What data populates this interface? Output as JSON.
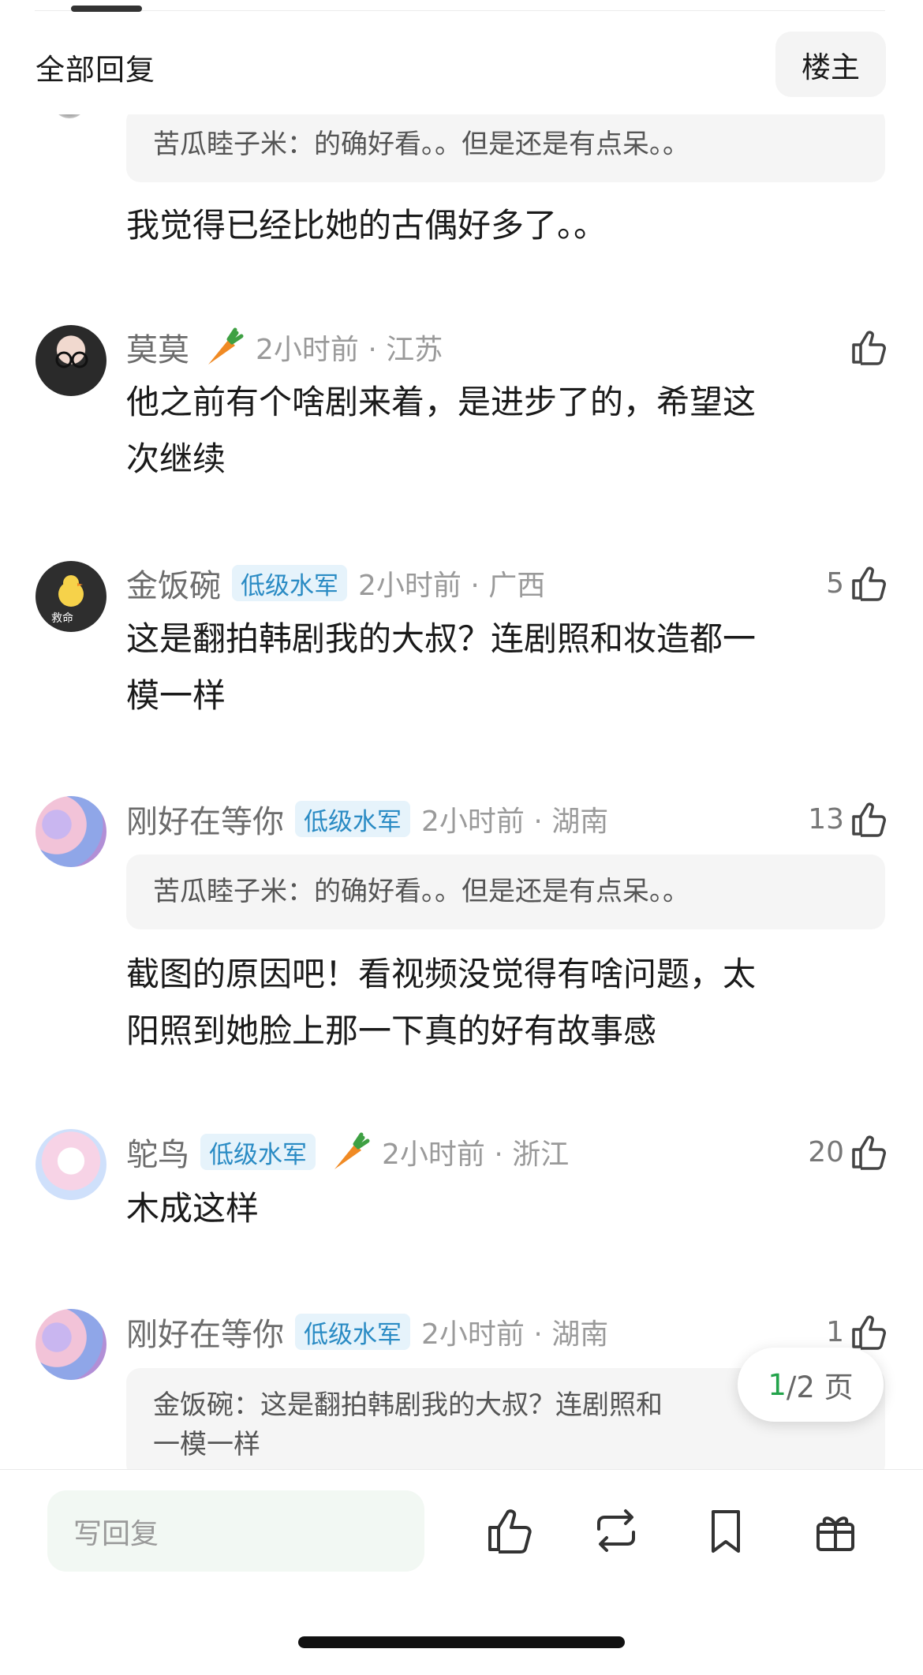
{
  "header": {
    "title": "全部回复",
    "op_button": "楼主"
  },
  "quote_top": "苦瓜睦子米：的确好看。。但是还是有点呆。。",
  "reply_top": "我觉得已经比她的古偶好多了。。",
  "comments": [
    {
      "name": "莫莫",
      "time_location": "2小时前 · 江苏",
      "likes": "",
      "text_line1": "他之前有个啥剧来着，是进步了的，希望这",
      "text_line2": "次继续"
    },
    {
      "name": "金饭碗",
      "badge": "低级水军",
      "time_location": "2小时前 · 广西",
      "likes": "5",
      "avatar_text": "救命",
      "text_line1": "这是翻拍韩剧我的大叔？连剧照和妆造都一",
      "text_line2": "模一样"
    },
    {
      "name": "刚好在等你",
      "badge": "低级水军",
      "time_location": "2小时前 · 湖南",
      "likes": "13",
      "quote": "苦瓜睦子米：的确好看。。但是还是有点呆。。",
      "text_line1": "截图的原因吧！看视频没觉得有啥问题，太",
      "text_line2": "阳照到她脸上那一下真的好有故事感"
    },
    {
      "name": "鸵鸟",
      "badge": "低级水军",
      "time_location": "2小时前 · 浙江",
      "likes": "20",
      "text_line1": "木成这样"
    },
    {
      "name": "刚好在等你",
      "badge": "低级水军",
      "time_location": "2小时前 · 湖南",
      "likes": "1",
      "quote_line1": "金饭碗：这是翻拍韩剧我的大叔？连剧照和",
      "quote_line2": "一模一样"
    }
  ],
  "pager": {
    "current": "1",
    "rest": "/2 页"
  },
  "bottom_bar": {
    "reply_placeholder": "写回复"
  },
  "colors": {
    "accent_green": "#23a34b",
    "badge_bg": "#e6f3fb",
    "badge_text": "#2a8bc4"
  }
}
